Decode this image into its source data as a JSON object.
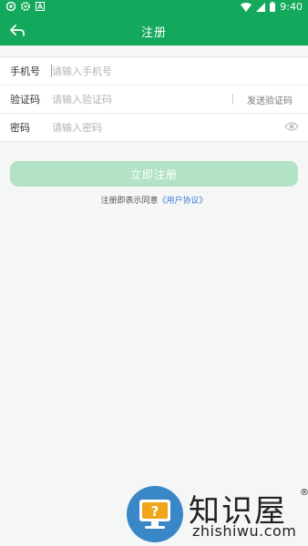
{
  "status_bar": {
    "time": "9:40",
    "icons": [
      "chrome-icon",
      "settings-icon",
      "accessibility-icon",
      "wifi-icon",
      "signal-icon",
      "battery-icon"
    ]
  },
  "app_bar": {
    "title": "注册",
    "back_icon": "back-arrow-icon"
  },
  "form": {
    "phone": {
      "label": "手机号",
      "placeholder": "请输入手机号"
    },
    "code": {
      "label": "验证码",
      "placeholder": "请输入验证码",
      "send_label": "发送验证码"
    },
    "password": {
      "label": "密码",
      "placeholder": "请输入密码",
      "toggle_icon": "eye-icon"
    }
  },
  "register_button": {
    "label": "立即注册"
  },
  "agreement": {
    "prefix": "注册即表示同意",
    "link_label": "《用户协议》"
  },
  "watermark": {
    "brand": "知识屋",
    "url": "zhishiwu.com",
    "registered": "®"
  },
  "colors": {
    "primary": "#13a85b",
    "button_disabled": "#b3e3c6",
    "link": "#3d7bd9",
    "watermark_blue": "#3a87c8"
  }
}
